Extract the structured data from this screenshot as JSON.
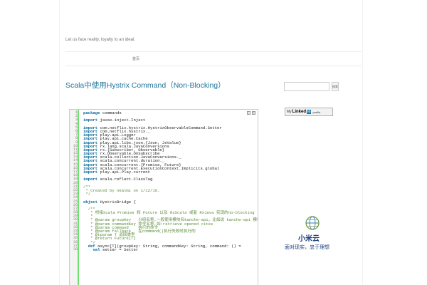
{
  "site": {
    "tagline": "Let us face reality, loyalty to an ideal.",
    "nav_item": "首页"
  },
  "post": {
    "title": "Scala中使用Hystrix Command（Non-Blocking）"
  },
  "code": {
    "lines": [
      {
        "n": "1",
        "t": "package commands",
        "k": "package"
      },
      {
        "n": "2",
        "t": ""
      },
      {
        "n": "3",
        "t": "import javax.inject.Inject",
        "k": "import"
      },
      {
        "n": "4",
        "t": ""
      },
      {
        "n": "5",
        "t": "import com.netflix.hystrix.HystrixObservableCommand.Setter",
        "k": "import"
      },
      {
        "n": "6",
        "t": "import com.netflix.hystrix._",
        "k": "import"
      },
      {
        "n": "7",
        "t": "import play.api.Logger",
        "k": "import"
      },
      {
        "n": "8",
        "t": "import play.api.cache.Cache",
        "k": "import"
      },
      {
        "n": "9",
        "t": "import play.api.libs.json.{Json, JsValue}",
        "k": "import"
      },
      {
        "n": "10",
        "t": "import rx.lang.scala.JavaConversions",
        "k": "import"
      },
      {
        "n": "11",
        "t": "import rx.{Subscriber, Observable}",
        "k": "import"
      },
      {
        "n": "12",
        "t": "import rx.Observable.OnSubscribe",
        "k": "import"
      },
      {
        "n": "13",
        "t": "import scala.collection.JavaConversions._",
        "k": "import"
      },
      {
        "n": "14",
        "t": "import scala.concurrent.duration._",
        "k": "import"
      },
      {
        "n": "15",
        "t": "import scala.concurrent.{Promise, Future}",
        "k": "import"
      },
      {
        "n": "16",
        "t": "import scala.concurrent.ExecutionContext.Implicits.global",
        "k": "import"
      },
      {
        "n": "17",
        "t": "import play.api.Play.current",
        "k": "import"
      },
      {
        "n": "18",
        "t": ""
      },
      {
        "n": "19",
        "t": "import scala.reflect.ClassTag",
        "k": "import"
      },
      {
        "n": "20",
        "t": ""
      },
      {
        "n": "21",
        "t": "/**",
        "c": true
      },
      {
        "n": "22",
        "t": " * Created by nealmi on 1/12/16.",
        "c": true
      },
      {
        "n": "23",
        "t": " */",
        "c": true
      },
      {
        "n": "24",
        "t": ""
      },
      {
        "n": "25",
        "t": "object HystrixBridge {",
        "k": "object"
      },
      {
        "n": "26",
        "t": ""
      },
      {
        "n": "27",
        "t": "  /**",
        "c": true
      },
      {
        "n": "28",
        "t": "   * 桥接Scala Promise 和 Future 以及 RxScala 或者 RxJava 实现的no-blocking",
        "c": true
      },
      {
        "n": "29",
        "t": "   *",
        "c": true
      },
      {
        "n": "30",
        "t": "   * @param groupKey   分组名称,一般使用模块名kanche-api，比如说 kanche-api 模块的",
        "c": true
      },
      {
        "n": "31",
        "t": "   * @param commandKey 命令名称,如:retrieve opened cites",
        "c": true
      },
      {
        "n": "32",
        "t": "   * @param command    执行的命令",
        "c": true
      },
      {
        "n": "33",
        "t": "   * @param fallback   在command()执行失败时执行的",
        "c": true
      },
      {
        "n": "34",
        "t": "   * @tparam T 返回类型",
        "c": true
      },
      {
        "n": "35",
        "t": "   * @return Future[T]",
        "c": true
      },
      {
        "n": "36",
        "t": "   */",
        "c": true
      },
      {
        "n": "37",
        "t": "  def async[T](groupKey: String, commandKey: String, command: () =",
        "k": "def"
      },
      {
        "n": "38",
        "t": "    val setter = Setter",
        "k": "val"
      }
    ]
  },
  "sidebar": {
    "search_placeholder": "",
    "search_button": "搜索",
    "linkedin": {
      "my": "My",
      "name": "Linked",
      "in": "in",
      "profile": "profile"
    },
    "logo": {
      "name": "小米云",
      "slogan": "面对现实，忠于理想"
    }
  },
  "colors": {
    "accent": "#21759b",
    "gutter_bar": "#6ce26c",
    "linkedin_blue": "#0e76a8"
  }
}
